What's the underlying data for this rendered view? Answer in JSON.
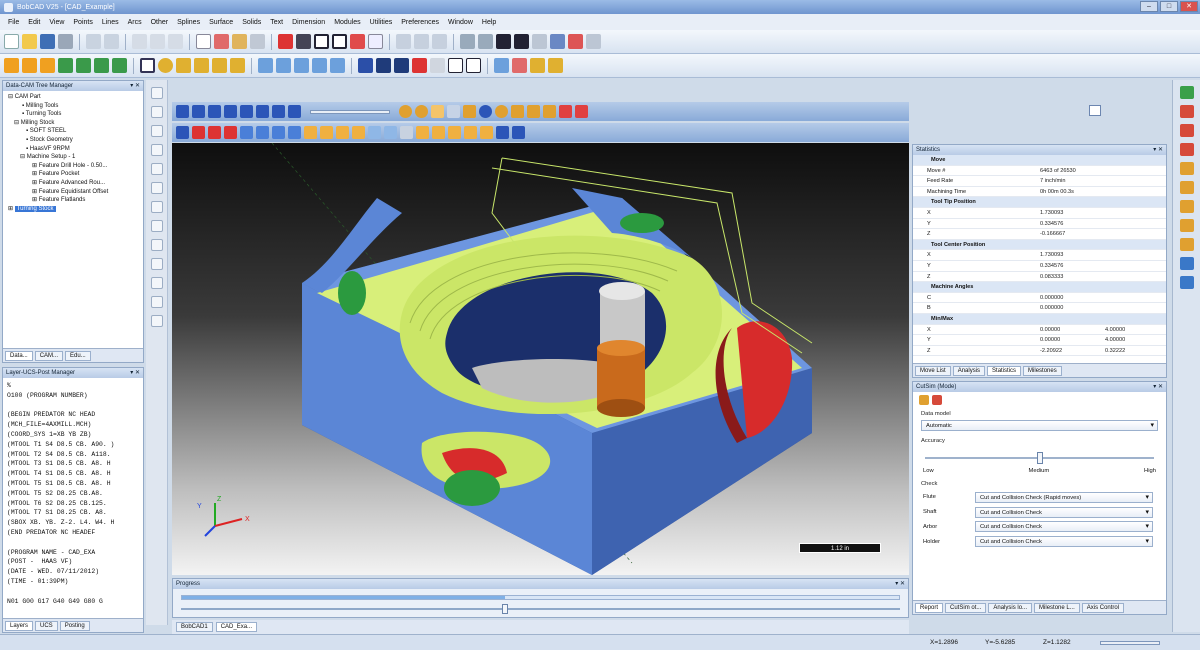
{
  "window": {
    "title": "BobCAD V25 - [CAD_Example]"
  },
  "menu": [
    "File",
    "Edit",
    "View",
    "Points",
    "Lines",
    "Arcs",
    "Other",
    "Splines",
    "Surface",
    "Solids",
    "Text",
    "Dimension",
    "Modules",
    "Utilities",
    "Preferences",
    "Window",
    "Help"
  ],
  "tree_panel": {
    "title": "Data-CAM Tree Manager",
    "items": [
      "CAM Part",
      "Milling Tools",
      "Turning Tools",
      "Milling Stock",
      "SOFT STEEL",
      "Stock Geometry",
      "HaasVF 9RPM",
      "Machine Setup - 1",
      "Feature Drill Hole - 0.50...",
      "Feature Pocket",
      "Feature Advanced Rou...",
      "Feature Equidistant Offset",
      "Feature Flatlands",
      "Turning Stock"
    ],
    "tabs": [
      "Data...",
      "CAM...",
      "Edu..."
    ]
  },
  "nc_panel": {
    "title": "Layer-UCS-Post Manager",
    "lines": [
      "%",
      "O100 (PROGRAM NUMBER)",
      "",
      "(BEGIN PREDATOR NC HEAD",
      "(MCH_FILE=4AXMILL.MCH)",
      "(COORD_SYS 1=XB YB ZB)",
      "(MTOOL T1 S4 D8.5 CB. A90. )",
      "(MTOOL T2 S4 D8.5 CB. A118.",
      "(MTOOL T3 S1 D8.5 CB. A8. H",
      "(MTOOL T4 S1 D8.5 CB. A8. H",
      "(MTOOL T5 S1 D8.5 CB. A8. H",
      "(MTOOL T5 S2 D8.25 CB.A8.",
      "(MTOOL T6 S2 D8.25 CB.125.",
      "(MTOOL T7 S1 D8.25 CB. A8.",
      "(SBOX XB. YB. Z-2. L4. W4. H",
      "(END PREDATOR NC HEADEF",
      "",
      "(PROGRAM NAME - CAD_EXA",
      "(POST -  HAAS VF)",
      "(DATE - WED. 07/11/2012)",
      "(TIME - 01:39PM)",
      "",
      "N01 G00 G17 G40 G49 G80 G"
    ],
    "tabs": [
      "Layers",
      "UCS",
      "Posting"
    ]
  },
  "viewport": {
    "scale_label": "1.12 in"
  },
  "stats_panel": {
    "title": "Statistics",
    "move": {
      "label": "Move",
      "rows": [
        [
          "Move #",
          "6463 of 26530"
        ],
        [
          "Feed Rate",
          "7 inch/min"
        ],
        [
          "Machining Time",
          "0h 00m 00.3s"
        ]
      ]
    },
    "tooltip": {
      "label": "Tool Tip Position",
      "rows": [
        [
          "X",
          "1.730093"
        ],
        [
          "Y",
          "0.334576"
        ],
        [
          "Z",
          "-0.166667"
        ]
      ]
    },
    "toolcenter": {
      "label": "Tool Center Position",
      "rows": [
        [
          "X",
          "1.730093"
        ],
        [
          "Y",
          "0.334576"
        ],
        [
          "Z",
          "0.083333"
        ]
      ]
    },
    "angles": {
      "label": "Machine Angles",
      "rows": [
        [
          "C",
          "0.000000"
        ],
        [
          "B",
          "0.000000"
        ]
      ]
    },
    "minmax": {
      "label": "Min/Max",
      "rows": [
        [
          "X",
          "0.00000",
          "4.00000"
        ],
        [
          "Y",
          "0.00000",
          "4.00000"
        ],
        [
          "Z",
          "-2.20922",
          "0.32222"
        ]
      ]
    },
    "tabs": [
      "Move List",
      "Analysis",
      "Statistics",
      "Milestones"
    ]
  },
  "cutsim_panel": {
    "title": "CutSim (Mode)",
    "data_model_label": "Data model",
    "data_model_value": "Automatic",
    "accuracy_label": "Accuracy",
    "accuracy_low": "Low",
    "accuracy_mid": "Medium",
    "accuracy_high": "High",
    "accuracy_level": 0.5,
    "check_label": "Check",
    "checks": [
      [
        "Flute",
        "Cut and Collision Check (Rapid moves)"
      ],
      [
        "Shaft",
        "Cut and Collision Check"
      ],
      [
        "Arbor",
        "Cut and Collision Check"
      ],
      [
        "Holder",
        "Cut and Collision Check"
      ]
    ],
    "tabs": [
      "Report",
      "CutSim ot...",
      "Analysis lo...",
      "Milestone L...",
      "Axis Control"
    ]
  },
  "progress_panel": {
    "title": "Progress",
    "value": 0.45
  },
  "doc_tabs": [
    "BobCAD1",
    "CAD_Exa..."
  ],
  "status": {
    "x": "X=1.2896",
    "y": "Y=-5.6285",
    "z": "Z=1.1282"
  },
  "colors": {
    "stock_blue": "#5b86d6",
    "machined_green": "#d8ef7a",
    "tool_orange": "#c96a1c",
    "tool_gray": "#c8c8c8",
    "gouge_red": "#d92b2b"
  }
}
